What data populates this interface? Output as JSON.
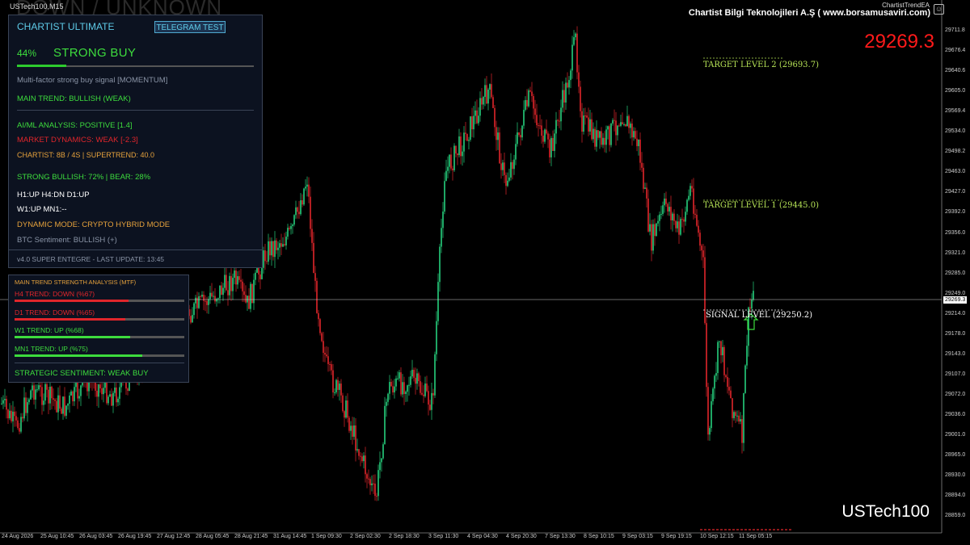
{
  "chart": {
    "symbol_tf": "USTech100,M15",
    "watermark": "DOWN / UNKNOWN",
    "company": "Chartist Bilgi Teknolojileri A.Ş ( www.borsamusaviri.com)",
    "ea_name": "ChartistTrendEA",
    "smile": "☺",
    "current_price": "29269.3",
    "current_price_box": "29269.3",
    "bottom_symbol": "USTech100",
    "colors": {
      "bull": "#26d07c",
      "bear": "#e0262b",
      "background": "#000000",
      "target": "#b6e356"
    }
  },
  "price_axis": [
    "29711.8",
    "29676.4",
    "29640.6",
    "29605.0",
    "29569.4",
    "29534.0",
    "29498.2",
    "29463.0",
    "29427.0",
    "29392.0",
    "29356.0",
    "29321.0",
    "29285.0",
    "29249.0",
    "29214.0",
    "29178.0",
    "29143.0",
    "29107.0",
    "29072.0",
    "29036.0",
    "29001.0",
    "28965.0",
    "28930.0",
    "28894.0",
    "28859.0"
  ],
  "time_axis": [
    "24 Aug 2026",
    "25 Aug 10:45",
    "26 Aug 03:45",
    "26 Aug 19:45",
    "27 Aug 12:45",
    "28 Aug 05:45",
    "28 Aug 21:45",
    "31 Aug 14:45",
    "1 Sep 09:30",
    "2 Sep 02:30",
    "2 Sep 18:30",
    "3 Sep 11:30",
    "4 Sep 04:30",
    "4 Sep 20:30",
    "7 Sep 13:30",
    "8 Sep 10:15",
    "9 Sep 03:15",
    "9 Sep 19:15",
    "10 Sep 12:15",
    "11 Sep 05:15"
  ],
  "levels": {
    "target2": "TARGET LEVEL 2 (29693.7)",
    "target1": "TARGET LEVEL 1 (29445.0)",
    "signal": "SIGNAL LEVEL (29250.2)"
  },
  "panel": {
    "title": "CHARTIST ULTIMATE",
    "telegram_button": "TELEGRAM TEST",
    "percent": "44%",
    "percent_value": 44,
    "signal": "STRONG BUY",
    "description": "Multi-factor strong buy signal [MOMENTUM]",
    "main_trend": "MAIN TREND: BULLISH (WEAK)",
    "ai_ml": "AI/ML ANALYSIS: POSITIVE [1.4]",
    "market_dynamics": "MARKET DYNAMICS: WEAK [-2.3]",
    "chartist": "CHARTIST: 8B / 4S | SUPERTREND: 40.0",
    "strength": "STRONG BULLISH: 72% | BEAR: 28%",
    "tf1": "H1:UP H4:DN D1:UP",
    "tf2": "W1:UP MN1:--",
    "dynamic_mode": "DYNAMIC MODE: CRYPTO HYBRID MODE",
    "btc": "BTC Sentiment: BULLISH (+)",
    "footer": "v4.0 SUPER ENTEGRE - LAST UPDATE: 13:45"
  },
  "mtf": {
    "title": "MAIN TREND STRENGTH ANALYSIS (MTF)",
    "rows": [
      {
        "label": "H4 TREND: DOWN (%67)",
        "value": 67,
        "color": "#e0262b"
      },
      {
        "label": "D1 TREND: DOWN (%65)",
        "value": 65,
        "color": "#e0262b"
      },
      {
        "label": "W1 TREND: UP (%68)",
        "value": 68,
        "color": "#3ddc3d"
      },
      {
        "label": "MN1 TREND: UP (%75)",
        "value": 75,
        "color": "#3ddc3d"
      }
    ],
    "strategic": "STRATEGIC SENTIMENT: WEAK BUY"
  }
}
